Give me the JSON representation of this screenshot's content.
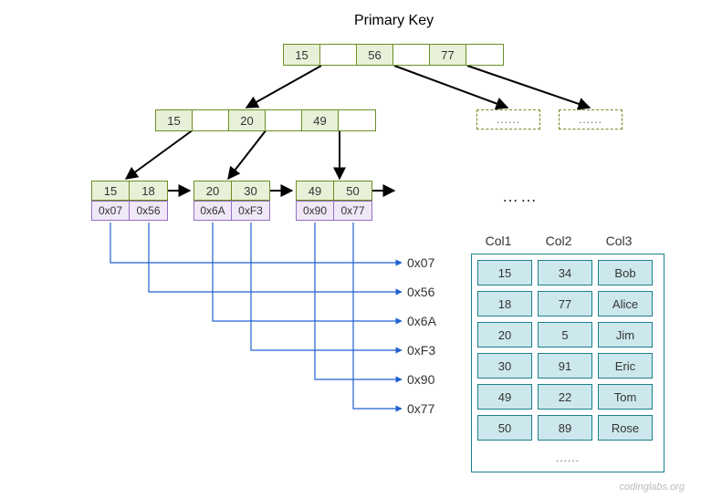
{
  "title": "Primary Key",
  "root": {
    "keys": [
      "15",
      "56",
      "77"
    ]
  },
  "internal": {
    "keys": [
      "15",
      "20",
      "49"
    ]
  },
  "ghosts": [
    "......",
    "......"
  ],
  "leaves": [
    {
      "keys": [
        "15",
        "18"
      ],
      "ptrs": [
        "0x07",
        "0x56"
      ]
    },
    {
      "keys": [
        "20",
        "30"
      ],
      "ptrs": [
        "0x6A",
        "0xF3"
      ]
    },
    {
      "keys": [
        "49",
        "50"
      ],
      "ptrs": [
        "0x90",
        "0x77"
      ]
    }
  ],
  "ptr_labels": [
    "0x07",
    "0x56",
    "0x6A",
    "0xF3",
    "0x90",
    "0x77"
  ],
  "leaf_more": "……",
  "table": {
    "headers": [
      "Col1",
      "Col2",
      "Col3"
    ],
    "rows": [
      [
        "15",
        "34",
        "Bob"
      ],
      [
        "18",
        "77",
        "Alice"
      ],
      [
        "20",
        "5",
        "Jim"
      ],
      [
        "30",
        "91",
        "Eric"
      ],
      [
        "49",
        "22",
        "Tom"
      ],
      [
        "50",
        "89",
        "Rose"
      ]
    ],
    "more": "......"
  },
  "watermark": "codinglabs.org"
}
